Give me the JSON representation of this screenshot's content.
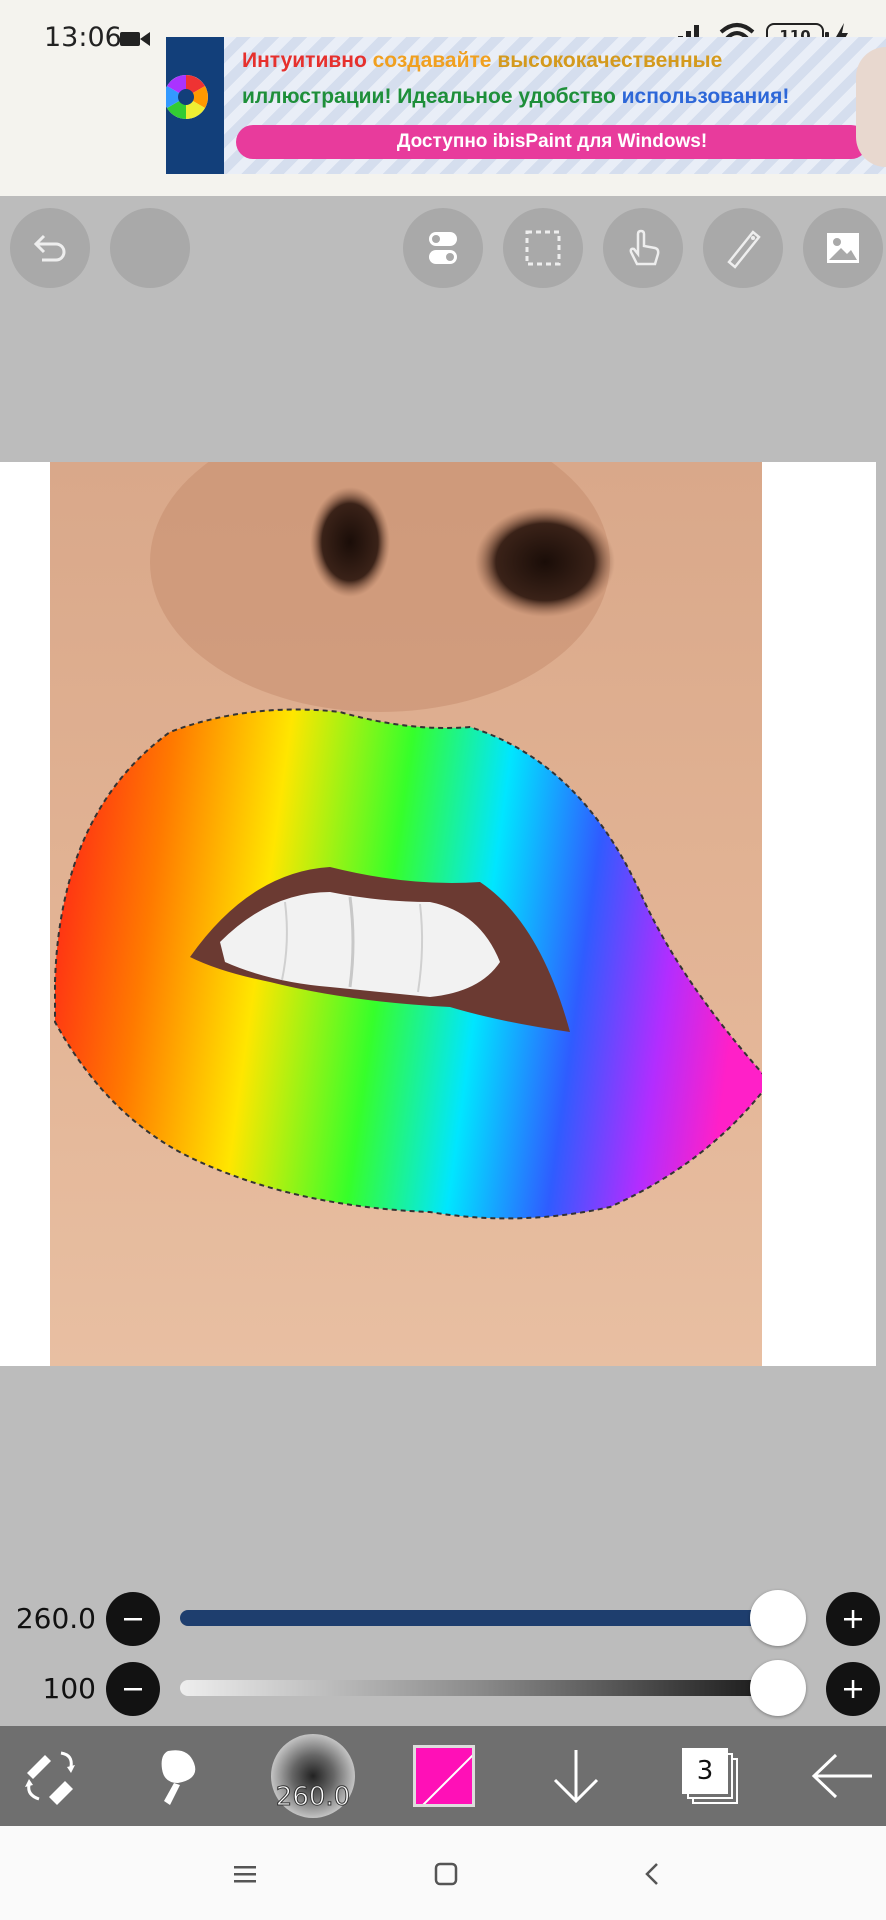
{
  "status_bar": {
    "time": "13:06",
    "battery": "110"
  },
  "ad": {
    "line1_red": "Интуитивно ",
    "line1_orange": "создавайте ",
    "line1_rest": "высококачественные",
    "line2_green": "иллюстрации! Идеальное удобство ",
    "line2_blue": "использования!",
    "button": "Доступно ibisPaint для Windows!"
  },
  "toolbar": {
    "buttons": [
      "undo-icon",
      "blank",
      "toggle-icon",
      "selection-icon",
      "touch-icon",
      "ruler-icon",
      "image-icon"
    ]
  },
  "sliders": {
    "size_value": "260.0",
    "size_level": 1.0,
    "opacity_value": "100",
    "opacity_level": 1.0
  },
  "bottom_bar": {
    "brush_size": "260.0",
    "color": "#ff10b7",
    "layer_count": "3"
  },
  "colors": {
    "toolbar_bg": "#bcbcbc",
    "size_track": "#1e3e6e",
    "bottom_bar": "#6f6f6f",
    "ad_button": "#e83b9c"
  }
}
